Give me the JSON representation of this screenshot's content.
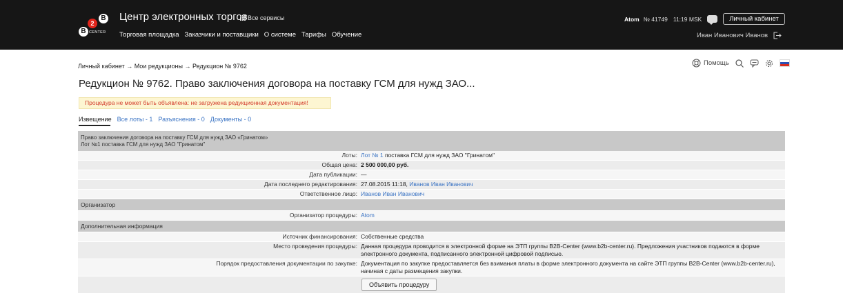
{
  "header": {
    "logo": {
      "letter_top": "B",
      "letter_left": "B",
      "badge": "2",
      "sub": "CENTER"
    },
    "title": "Центр электронных торгов",
    "all_services": "Все сервисы",
    "nav": [
      "Торговая площадка",
      "Заказчики и поставщики",
      "О системе",
      "Тарифы",
      "Обучение"
    ],
    "user_org": "Atom",
    "user_number": "№ 41749",
    "time": "11:19 MSK",
    "cabinet_label": "Личный кабинет",
    "user_name": "Иван Иванович Иванов"
  },
  "breadcrumb": "Личный кабинет → Мои редукционы → Редукцион № 9762",
  "tools": {
    "help": "Помощь"
  },
  "flag_colors": [
    "#ffffff",
    "#2b4fb3",
    "#d52b1e"
  ],
  "title": "Редукцион № 9762. Право заключения договора на поставку ГСМ для нужд ЗАО...",
  "warning": "Процедура не может быть объявлена: не загружена редукционная документация!",
  "tabs": [
    {
      "label": "Извещение"
    },
    {
      "label": "Все лоты - 1"
    },
    {
      "label": "Разъяснения - 0"
    },
    {
      "label": "Документы - 0"
    }
  ],
  "caption": {
    "line1": "Право заключения договора на поставку ГСМ для нужд ЗАО «Гринатом»",
    "line2": "Лот №1 поставка ГСМ для нужд ЗАО \"Гринатом\""
  },
  "details": {
    "lots": {
      "label": "Лоты:",
      "link": "Лот № 1",
      "text": " поставка ГСМ для нужд ЗАО \"Гринатом\""
    },
    "total_price": {
      "label": "Общая цена:",
      "value": "2 500 000,00 руб."
    },
    "publish_date": {
      "label": "Дата публикации:",
      "value": "—"
    },
    "last_edit": {
      "label": "Дата последнего редактирования:",
      "value": "27.08.2015 11:18, ",
      "link": "Иванов Иван Иванович"
    },
    "responsible": {
      "label": "Ответственное лицо:",
      "link": "Иванов Иван Иванович"
    }
  },
  "organizer_section": "Организатор",
  "organizer": {
    "label": "Организатор процедуры:",
    "link": "Atom"
  },
  "extra_section": "Дополнительная информация",
  "extra": {
    "funding": {
      "label": "Источник финансирования:",
      "value": "Собственные средства"
    },
    "place": {
      "label": "Место проведения процедуры:",
      "value": "Данная процедура проводится в электронной форме на ЭТП группы B2B-Center (www.b2b-center.ru). Предложения участников подаются в форме электронного документа, подписанного электронной цифровой подписью."
    },
    "docs": {
      "label": "Порядок предоставления документации по закупке:",
      "value": "Документация по закупке предоставляется без взимания платы в форме электронного документа на сайте ЭТП группы B2B-Center (www.b2b-center.ru), начиная с даты размещения закупки."
    }
  },
  "announce_button": "Объявить процедуру"
}
